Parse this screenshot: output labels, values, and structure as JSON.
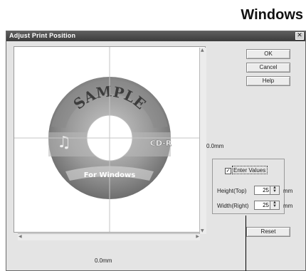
{
  "heading": "Windows",
  "window": {
    "title": "Adjust Print Position"
  },
  "preview": {
    "disc_top_text": "SAMPLE",
    "disc_bottom_text": "For Windows",
    "disc_right_text": "CD-R"
  },
  "readouts": {
    "vertical": "0.0mm",
    "horizontal": "0.0mm"
  },
  "buttons": {
    "ok": "OK",
    "cancel": "Cancel",
    "help": "Help",
    "reset": "Reset"
  },
  "enter_values": {
    "label": "Enter Values",
    "checked": true
  },
  "fields": {
    "height": {
      "label": "Height(Top)",
      "value": "25",
      "unit": "mm"
    },
    "width": {
      "label": "Width(Right)",
      "value": "25",
      "unit": "mm"
    }
  },
  "icons": {
    "close": "close-icon",
    "music": "music-note-icon",
    "scroll_up": "arrow-up-icon",
    "scroll_down": "arrow-down-icon",
    "scroll_left": "arrow-left-icon",
    "scroll_right": "arrow-right-icon",
    "spin": "spin-arrows-icon",
    "check": "checkmark-icon"
  },
  "colors": {
    "titlebar": "#444444",
    "dialog_bg": "#e4e4e4",
    "preview_bg": "#ffffff"
  }
}
